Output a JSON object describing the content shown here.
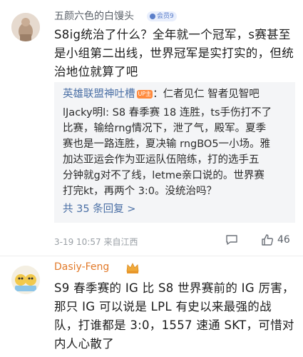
{
  "comments": [
    {
      "username": "五颜六色的白馒头",
      "badge": "会员9",
      "text_lines": [
        "S8ig统治了什么？全年就一个冠军，s赛甚至",
        "是小组第二出线，世界冠军是实打实的，但统",
        "治地位就算了吧"
      ],
      "reply": {
        "author": "英雄联盟神吐槽",
        "author_badge": "UP主",
        "author_text": "：仁者见仁 智者见智吧",
        "lines": [
          "lJacky明l: S8 春季赛 18 连胜，ts手伤打不了",
          "比赛，输给rng情况下，泄了气，殿军。夏季",
          "赛也是一路连胜，夏决输 rngBO5一小场。雅",
          "加达亚运会作为亚运队伍陪练，打的选手五",
          "分钟就g对不了线，letme亲口说的。世界赛",
          "打完kt，再两个 3:0。没统治吗？"
        ],
        "more": "共 35 条回复 >"
      },
      "meta": "3-19 10:57 来自江西",
      "likes": "46"
    },
    {
      "username": "Dasiy-Feng",
      "text_lines": [
        "S9 春季赛的 IG 比 S8 世界赛前的 IG 厉害，",
        "那只 IG 可以说是 LPL 有史以来最强的战",
        "队，打谁都是 3:0，1557 速通 SKT，可惜对",
        "内人心散了"
      ]
    }
  ],
  "colors": {
    "link": "#4a6fa5",
    "username_vip": "#e27a2a",
    "meta": "#9aa0a6"
  }
}
